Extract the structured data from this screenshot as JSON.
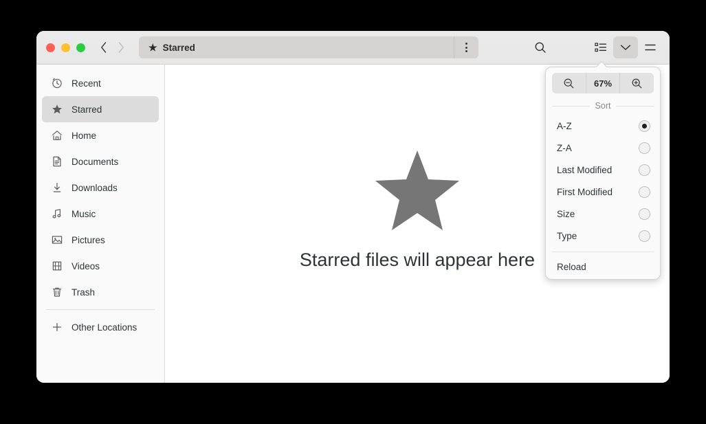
{
  "window": {
    "traffic_lights": [
      {
        "name": "close",
        "color": "#ff6159"
      },
      {
        "name": "minimize",
        "color": "#ffc12f"
      },
      {
        "name": "maximize",
        "color": "#29ce41"
      }
    ]
  },
  "header": {
    "back_icon": "chevron-left-icon",
    "forward_icon": "chevron-right-icon",
    "path": {
      "icon": "star-icon",
      "label": "Starred"
    },
    "kebab_icon": "more-options-icon",
    "search_icon": "search-icon",
    "list_view_icon": "list-view-icon",
    "view_options_icon": "chevron-down-icon",
    "menu_icon": "hamburger-menu-icon"
  },
  "sidebar": {
    "items": [
      {
        "label": "Recent",
        "icon": "clock-icon",
        "selected": false
      },
      {
        "label": "Starred",
        "icon": "star-icon",
        "selected": true
      },
      {
        "label": "Home",
        "icon": "home-icon",
        "selected": false
      },
      {
        "label": "Documents",
        "icon": "document-icon",
        "selected": false
      },
      {
        "label": "Downloads",
        "icon": "download-icon",
        "selected": false
      },
      {
        "label": "Music",
        "icon": "music-icon",
        "selected": false
      },
      {
        "label": "Pictures",
        "icon": "picture-icon",
        "selected": false
      },
      {
        "label": "Videos",
        "icon": "video-icon",
        "selected": false
      },
      {
        "label": "Trash",
        "icon": "trash-icon",
        "selected": false
      }
    ],
    "other_locations": {
      "label": "Other Locations",
      "icon": "plus-icon"
    }
  },
  "content": {
    "empty_icon": "star-icon",
    "empty_text": "Starred files will appear here"
  },
  "popover": {
    "zoom": {
      "out_icon": "zoom-out-icon",
      "level": "67%",
      "in_icon": "zoom-in-icon"
    },
    "sort_label": "Sort",
    "sort_options": [
      {
        "label": "A-Z",
        "selected": true
      },
      {
        "label": "Z-A",
        "selected": false
      },
      {
        "label": "Last Modified",
        "selected": false
      },
      {
        "label": "First Modified",
        "selected": false
      },
      {
        "label": "Size",
        "selected": false
      },
      {
        "label": "Type",
        "selected": false
      }
    ],
    "reload_label": "Reload"
  }
}
